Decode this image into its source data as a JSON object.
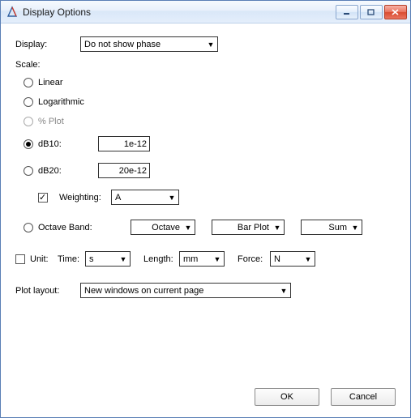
{
  "window": {
    "title": "Display Options"
  },
  "labels": {
    "display": "Display:",
    "scale": "Scale:",
    "linear": "Linear",
    "log": "Logarithmic",
    "pct": "% Plot",
    "db10": "dB10:",
    "db20": "dB20:",
    "weighting": "Weighting:",
    "octave": "Octave Band:",
    "unit": "Unit:",
    "time": "Time:",
    "length": "Length:",
    "force": "Force:",
    "plot_layout": "Plot layout:"
  },
  "values": {
    "display_sel": "Do not show phase",
    "db10_val": "1e-12",
    "db20_val": "20e-12",
    "weighting_sel": "A",
    "octave_sel": "Octave",
    "octave_plot": "Bar Plot",
    "octave_sum": "Sum",
    "unit_time": "s",
    "unit_length": "mm",
    "unit_force": "N",
    "plot_layout_sel": "New windows on current page"
  },
  "state": {
    "scale": "db10",
    "pct_enabled": false,
    "weighting_checked": true,
    "unit_checked": false
  },
  "buttons": {
    "ok": "OK",
    "cancel": "Cancel"
  }
}
